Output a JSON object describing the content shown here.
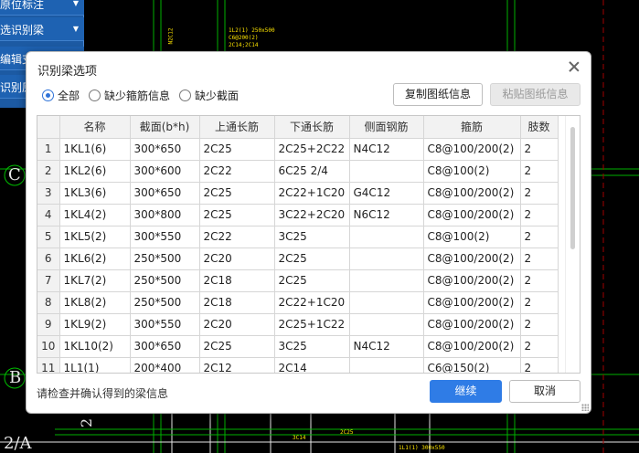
{
  "left_panel": {
    "items": [
      "原位标注",
      "选识别梁",
      "编辑支",
      "识别原"
    ]
  },
  "cad": {
    "axis_labels": [
      "C",
      "B",
      "2/A",
      "2"
    ],
    "texts": [
      "1L2(1) 250x500",
      "C6@200(2)",
      "2C14;2C14",
      "N2C12",
      "1L1(1) 300x550",
      "2C25",
      "3C14"
    ]
  },
  "dialog": {
    "title": "识别梁选项",
    "filters": [
      {
        "label": "全部",
        "checked": true
      },
      {
        "label": "缺少箍筋信息",
        "checked": false
      },
      {
        "label": "缺少截面",
        "checked": false
      }
    ],
    "copy_button": "复制图纸信息",
    "paste_button": "粘贴图纸信息",
    "columns": [
      "",
      "名称",
      "截面(b*h)",
      "上通长筋",
      "下通长筋",
      "侧面钢筋",
      "箍筋",
      "肢数"
    ],
    "rows": [
      [
        "1",
        "1KL1(6)",
        "300*650",
        "2C25",
        "2C25+2C22",
        "N4C12",
        "C8@100/200(2)",
        "2"
      ],
      [
        "2",
        "1KL2(6)",
        "300*600",
        "2C22",
        "6C25 2/4",
        "",
        "C8@100(2)",
        "2"
      ],
      [
        "3",
        "1KL3(6)",
        "300*650",
        "2C25",
        "2C22+1C20",
        "G4C12",
        "C8@100/200(2)",
        "2"
      ],
      [
        "4",
        "1KL4(2)",
        "300*800",
        "2C25",
        "3C22+2C20",
        "N6C12",
        "C8@100/200(2)",
        "2"
      ],
      [
        "5",
        "1KL5(2)",
        "300*550",
        "2C22",
        "3C25",
        "",
        "C8@100(2)",
        "2"
      ],
      [
        "6",
        "1KL6(2)",
        "250*500",
        "2C20",
        "2C25",
        "",
        "C8@100/200(2)",
        "2"
      ],
      [
        "7",
        "1KL7(2)",
        "250*500",
        "2C18",
        "2C25",
        "",
        "C8@100/200(2)",
        "2"
      ],
      [
        "8",
        "1KL8(2)",
        "250*500",
        "2C18",
        "2C22+1C20",
        "",
        "C8@100/200(2)",
        "2"
      ],
      [
        "9",
        "1KL9(2)",
        "300*550",
        "2C20",
        "2C25+1C22",
        "",
        "C8@100/200(2)",
        "2"
      ],
      [
        "10",
        "1KL10(2)",
        "300*650",
        "2C25",
        "3C25",
        "N4C12",
        "C8@100/200(2)",
        "2"
      ],
      [
        "11",
        "1L1(1)",
        "200*400",
        "2C12",
        "2C14",
        "",
        "C6@150(2)",
        "2"
      ]
    ],
    "hint": "请检查并确认得到的梁信息",
    "continue_button": "继续",
    "cancel_button": "取消"
  },
  "colors": {
    "accent": "#2f7ce6",
    "cad_line_green": "#00c000",
    "cad_line_white": "#e6e6e6",
    "cad_text_yellow": "#ffe600"
  }
}
